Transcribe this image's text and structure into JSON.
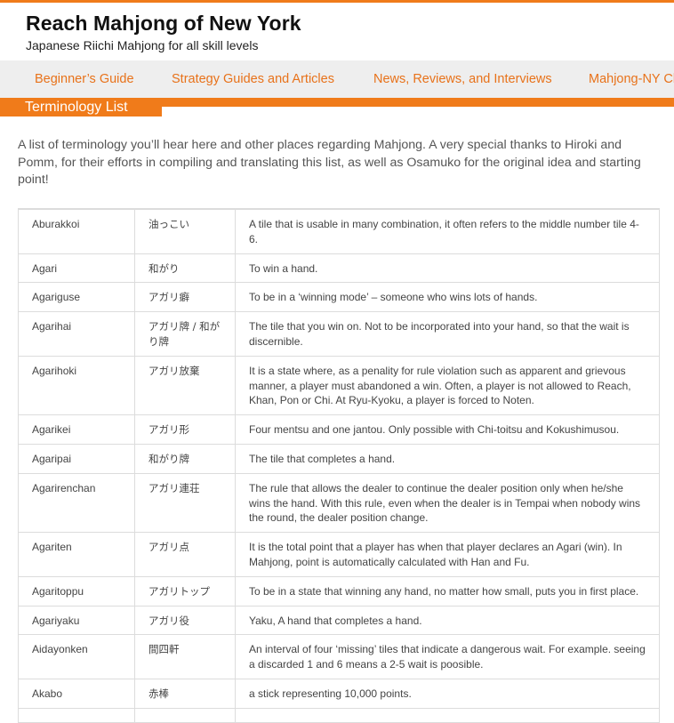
{
  "site": {
    "title": "Reach Mahjong of New York",
    "tagline": "Japanese Riichi Mahjong for all skill levels"
  },
  "nav": {
    "items": [
      "Beginner’s Guide",
      "Strategy Guides and Articles",
      "News, Reviews, and Interviews",
      "Mahjong-NY Cl"
    ]
  },
  "page": {
    "tab_label": "Terminology List",
    "intro": "A list of terminology you’ll hear here and other places regarding Mahjong. A very special thanks to Hiroki and Pomm, for their efforts in compiling and translating this list, as well as Osamuko for the original idea and starting point!"
  },
  "colors": {
    "accent": "#f07b1a",
    "nav_bg": "#eeeeee"
  },
  "terms": [
    {
      "term": "Aburakkoi",
      "japanese": "油っこい",
      "definition": "A tile that is usable in many combination, it often refers to the middle number tile 4-6."
    },
    {
      "term": "Agari",
      "japanese": "和がり",
      "definition": "To win a hand."
    },
    {
      "term": "Agariguse",
      "japanese": "アガリ癖",
      "definition": "To be in a ‘winning mode’ – someone who wins lots of hands."
    },
    {
      "term": "Agarihai",
      "japanese": "アガリ牌 / 和がり牌",
      "definition": "The tile that you win on. Not to be incorporated into your hand, so that the wait is discernible."
    },
    {
      "term": "Agarihoki",
      "japanese": "アガリ放棄",
      "definition": "It is a state where, as a penality for rule violation such as apparent and grievous manner, a player must abandoned a win. Often, a player is not allowed to Reach, Khan, Pon or Chi. At Ryu-Kyoku, a player is forced to Noten."
    },
    {
      "term": "Agarikei",
      "japanese": "アガリ形",
      "definition": "Four mentsu and one jantou. Only possible with Chi-toitsu and Kokushimusou."
    },
    {
      "term": "Agaripai",
      "japanese": "和がり牌",
      "definition": "The tile that completes a hand."
    },
    {
      "term": "Agarirenchan",
      "japanese": "アガリ連荘",
      "definition": "The rule that allows the dealer to continue the dealer position only when he/she wins the hand. With this rule, even when the dealer is in Tempai when nobody wins the round, the dealer position change."
    },
    {
      "term": "Agariten",
      "japanese": "アガリ点",
      "definition": "It is the total point that a player has when that player declares an Agari (win). In Mahjong, point is automatically calculated with Han and Fu."
    },
    {
      "term": "Agaritoppu",
      "japanese": "アガリトップ",
      "definition": "To be in a state that winning any hand, no matter how small, puts you in first place."
    },
    {
      "term": "Agariyaku",
      "japanese": "アガリ役",
      "definition": "Yaku, A hand that completes a hand."
    },
    {
      "term": "Aidayonken",
      "japanese": "間四軒",
      "definition": "An interval of four ‘missing’ tiles that indicate a dangerous wait. For example. seeing a discarded 1 and 6 means a 2-5 wait is poosible."
    },
    {
      "term": "Akabo",
      "japanese": "赤棒",
      "definition": "a stick representing 10,000 points."
    },
    {
      "term": "",
      "japanese": "",
      "definition": ""
    }
  ]
}
